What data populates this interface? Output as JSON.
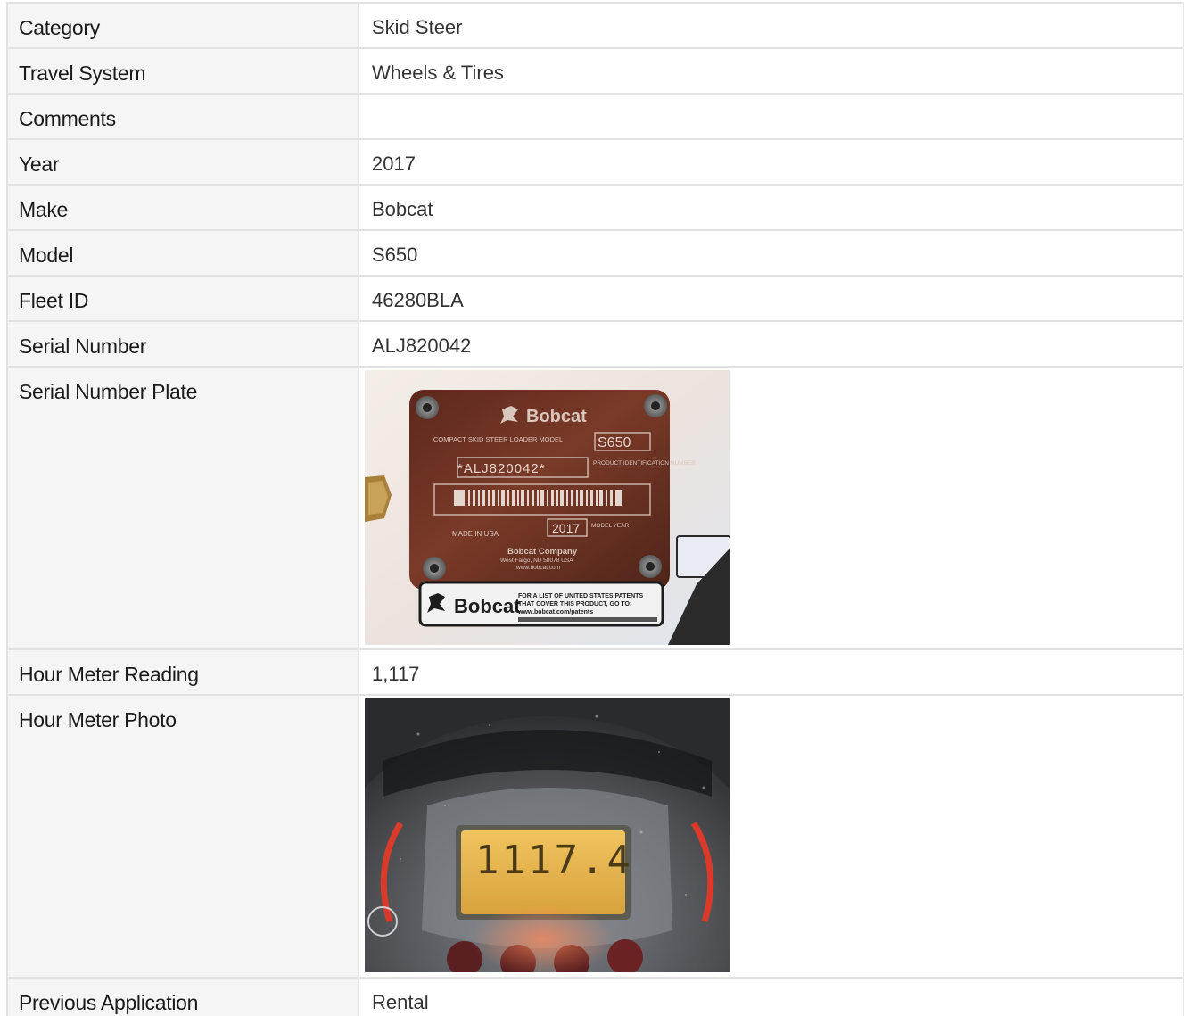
{
  "rows": [
    {
      "label": "Category",
      "value": "Skid Steer"
    },
    {
      "label": "Travel System",
      "value": "Wheels & Tires"
    },
    {
      "label": "Comments",
      "value": ""
    },
    {
      "label": "Year",
      "value": "2017"
    },
    {
      "label": "Make",
      "value": "Bobcat"
    },
    {
      "label": "Model",
      "value": "S650"
    },
    {
      "label": "Fleet ID",
      "value": "46280BLA"
    },
    {
      "label": "Serial Number",
      "value": "ALJ820042"
    },
    {
      "label": "Serial Number Plate",
      "value": ""
    },
    {
      "label": "Hour Meter Reading",
      "value": "1,117"
    },
    {
      "label": "Hour Meter Photo",
      "value": ""
    },
    {
      "label": "Previous Application",
      "value": "Rental"
    }
  ],
  "serial_plate_photo": {
    "brand": "Bobcat",
    "model_caption": "COMPACT SKID STEER LOADER MODEL",
    "model": "S650",
    "pin": "*ALJ820042*",
    "pin_caption": "PRODUCT IDENTIFICATION NUMBER",
    "made_in": "MADE IN USA",
    "year": "2017",
    "year_caption": "MODEL YEAR",
    "company": "Bobcat Company",
    "address": "West Fargo, ND 58078 USA",
    "web": "www.bobcat.com",
    "patent_text_1": "FOR A LIST OF UNITED STATES PATENTS",
    "patent_text_2": "THAT COVER THIS PRODUCT, GO TO:",
    "patent_url": "www.bobcat.com/patents"
  },
  "hour_meter_photo": {
    "display": "1117.4"
  },
  "colors": {
    "plate": "#6b2f22",
    "display": "#e9b54a",
    "border": "#e2e2e2",
    "label_bg": "#f5f5f5"
  }
}
